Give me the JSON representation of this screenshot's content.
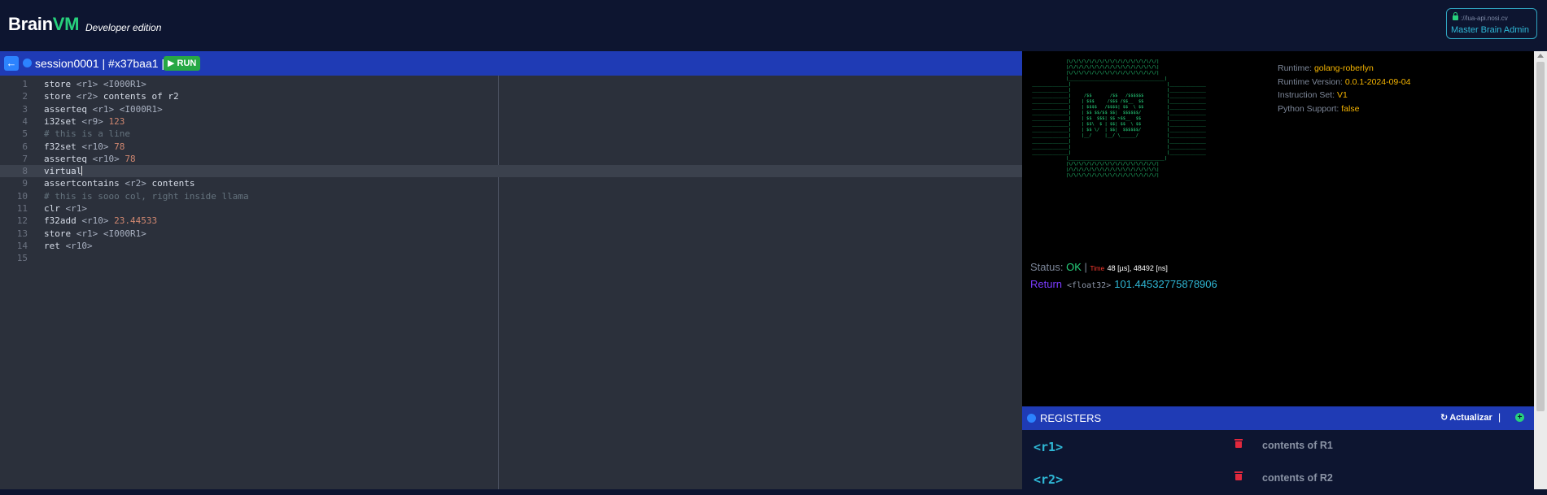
{
  "header": {
    "brand_left": "Brain",
    "brand_right": "VM",
    "edition": "Developer edition",
    "admin_host": "://lua-api.nosi.cv",
    "admin_name": "Master Brain Admin"
  },
  "editor": {
    "session_title": "session0001 | #x37baa1 |",
    "run_label": "▶ RUN",
    "back_icon": "arrow-left-icon",
    "active_line": 8,
    "lines": [
      {
        "n": "1",
        "parts": [
          {
            "t": "store ",
            "c": "code"
          },
          {
            "t": "<r1> <I000R1>",
            "c": "arg"
          }
        ]
      },
      {
        "n": "2",
        "parts": [
          {
            "t": "store ",
            "c": "code"
          },
          {
            "t": "<r2>",
            "c": "arg"
          },
          {
            "t": " contents of r2",
            "c": "code"
          }
        ]
      },
      {
        "n": "3",
        "parts": [
          {
            "t": "asserteq ",
            "c": "code"
          },
          {
            "t": "<r1> <I000R1>",
            "c": "arg"
          }
        ]
      },
      {
        "n": "4",
        "parts": [
          {
            "t": "i32set ",
            "c": "code"
          },
          {
            "t": "<r9> ",
            "c": "arg"
          },
          {
            "t": "123",
            "c": "num"
          }
        ]
      },
      {
        "n": "5",
        "parts": [
          {
            "t": "# this is a line",
            "c": "cmt"
          }
        ]
      },
      {
        "n": "6",
        "parts": [
          {
            "t": "f32set ",
            "c": "code"
          },
          {
            "t": "<r10> ",
            "c": "arg"
          },
          {
            "t": "78",
            "c": "num"
          }
        ]
      },
      {
        "n": "7",
        "parts": [
          {
            "t": "asserteq ",
            "c": "code"
          },
          {
            "t": "<r10> ",
            "c": "arg"
          },
          {
            "t": "78",
            "c": "num"
          }
        ]
      },
      {
        "n": "8",
        "parts": [
          {
            "t": "virtual",
            "c": "code"
          }
        ]
      },
      {
        "n": "9",
        "parts": [
          {
            "t": "assertcontains ",
            "c": "code"
          },
          {
            "t": "<r2>",
            "c": "arg"
          },
          {
            "t": " contents",
            "c": "code"
          }
        ]
      },
      {
        "n": "10",
        "parts": [
          {
            "t": "# this is sooo col, right inside llama",
            "c": "cmt"
          }
        ]
      },
      {
        "n": "11",
        "parts": [
          {
            "t": "clr ",
            "c": "code"
          },
          {
            "t": "<r1>",
            "c": "arg"
          }
        ]
      },
      {
        "n": "12",
        "parts": [
          {
            "t": "f32add ",
            "c": "code"
          },
          {
            "t": "<r10> ",
            "c": "arg"
          },
          {
            "t": "23.44533",
            "c": "num"
          }
        ]
      },
      {
        "n": "13",
        "parts": [
          {
            "t": "store ",
            "c": "code"
          },
          {
            "t": "<r1> <I000R1>",
            "c": "arg"
          }
        ]
      },
      {
        "n": "14",
        "parts": [
          {
            "t": "ret ",
            "c": "code"
          },
          {
            "t": "<r10>",
            "c": "arg"
          }
        ]
      },
      {
        "n": "15",
        "parts": []
      }
    ]
  },
  "console": {
    "ascii_art": "              |\\/\\/\\/\\/\\/\\/\\/\\/\\/\\/\\/\\/\\/\\/\\/\\/\\/|\n              |/\\/\\/\\/\\/\\/\\/\\/\\/\\/\\/\\/\\/\\/\\/\\/\\/\\|\n              |\\/\\/\\/\\/\\/\\/\\/\\/\\/\\/\\/\\/\\/\\/\\/\\/\\/|\n              |_____________________________________|\n ______________|                                     |______________\n ______________|                                     |______________\n ______________|     /$$       /$$   /$$$$$$         |______________\n ______________|    | $$$     /$$$ /$$__  $$         |______________\n ______________|    | $$$$   /$$$$| $$  \\ $$         |______________\n ______________|    | $$ $$/$$ $$|  $$$$$$/          |______________\n ______________|    | $$  $$$| $$ >$$__  $$          |______________\n ______________|    | $$\\  $ | $$| $$  \\ $$          |______________\n ______________|    | $$ \\/  | $$|  $$$$$$/          |______________\n ______________|    |__/     |__/ \\______/           |______________\n ______________|                                     |______________\n ______________|                                     |______________\n ______________|                                     |______________\n              |_____________________________________|\n              |\\/\\/\\/\\/\\/\\/\\/\\/\\/\\/\\/\\/\\/\\/\\/\\/\\/|\n              |/\\/\\/\\/\\/\\/\\/\\/\\/\\/\\/\\/\\/\\/\\/\\/\\/\\|\n              |\\/\\/\\/\\/\\/\\/\\/\\/\\/\\/\\/\\/\\/\\/\\/\\/\\/|",
    "runtime_label": "Runtime:",
    "runtime_value": "golang-roberlyn",
    "version_label": "Runtime Version:",
    "version_value": "0.0.1-2024-09-04",
    "iset_label": "Instruction Set:",
    "iset_value": "V1",
    "python_label": "Python Support:",
    "python_value": "false",
    "status_label": "Status:",
    "status_value": "OK",
    "status_sep": "|",
    "time_label": "Time",
    "time_value": "48 [µs], 48492 [ns]",
    "return_label": "Return",
    "return_type": "<float32>",
    "return_value": "101.44532775878906"
  },
  "registers": {
    "title": "REGISTERS",
    "refresh_label": "Actualizar",
    "separator": "|",
    "add_icon": "+",
    "items": [
      {
        "name": "<r1>",
        "value": "contents of R1"
      },
      {
        "name": "<r2>",
        "value": "contents of R2"
      }
    ]
  }
}
